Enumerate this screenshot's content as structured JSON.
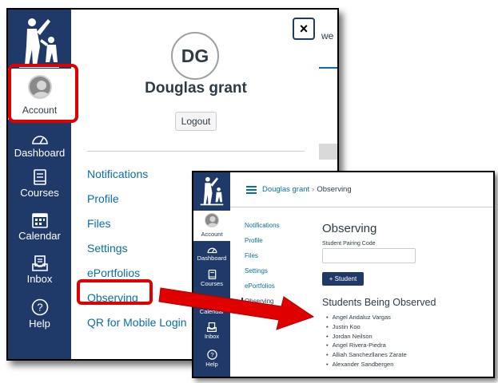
{
  "account_tray": {
    "avatar_initials": "DG",
    "user_name": "Douglas grant",
    "logout_label": "Logout",
    "close_label": "×",
    "background_fragment": "we",
    "links": [
      "Notifications",
      "Profile",
      "Files",
      "Settings",
      "ePortfolios",
      "Observing",
      "QR for Mobile Login"
    ]
  },
  "global_nav": {
    "items": [
      {
        "label": "Account",
        "icon": "user-avatar-icon"
      },
      {
        "label": "Dashboard",
        "icon": "speedometer-icon"
      },
      {
        "label": "Courses",
        "icon": "book-icon"
      },
      {
        "label": "Calendar",
        "icon": "calendar-icon"
      },
      {
        "label": "Inbox",
        "icon": "inbox-icon"
      },
      {
        "label": "Help",
        "icon": "help-circle-icon"
      }
    ]
  },
  "observing_page": {
    "breadcrumb_user": "Douglas grant",
    "breadcrumb_current": "Observing",
    "title": "Observing",
    "pairing_label": "Student Pairing Code",
    "add_student_label": "+ Student",
    "students_heading": "Students Being Observed",
    "students": [
      "Angel Andaluz Vargas",
      "Justin Koo",
      "Jordan Neilson",
      "Angel Rivera-Piedra",
      "Alliah Sanchezllanes Zarate",
      "Alexander Sandbergen"
    ],
    "subnav": [
      "Notifications",
      "Profile",
      "Files",
      "Settings",
      "ePortfolios",
      "Observing"
    ],
    "nav": {
      "account": "Account",
      "dashboard": "Dashboard",
      "courses": "Courses",
      "calendar": "Calendar",
      "inbox": "Inbox",
      "help": "Help"
    }
  },
  "colors": {
    "nav_blue": "#1f3a68",
    "link_blue": "#0770a3",
    "highlight_red": "#e00000"
  }
}
